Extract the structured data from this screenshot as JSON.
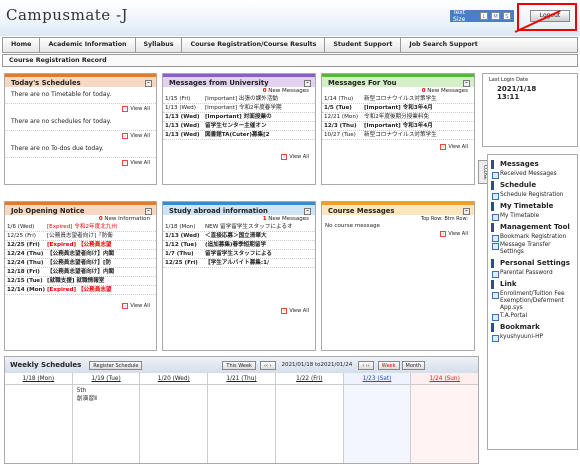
{
  "header": {
    "brand": "Campusmate -J",
    "text_size_label": "Text Size",
    "sizes": [
      "L",
      "M",
      "S"
    ],
    "logout": "Logout"
  },
  "nav": [
    "Home",
    "Academic Information",
    "Syllabus",
    "Course Registration/Course Results",
    "Student Support",
    "Job Search Support"
  ],
  "subnav": "Course Registration Record",
  "panels": {
    "todays": {
      "title": "Today's Schedules",
      "timetable": "There are no Timetable for today.",
      "schedules": "There are no schedules for today.",
      "todos": "There are no To-dos due today.",
      "view_all": "View All"
    },
    "university": {
      "title": "Messages from University",
      "new_count": "0",
      "new_label": "New Messages",
      "view_all": "View All",
      "rows": [
        {
          "date": "1/15 (Fri)",
          "text": "[Important] 出張の課外活動"
        },
        {
          "date": "1/13 (Wed)",
          "text": "[Important] 令和2年度春学期"
        },
        {
          "date": "1/13 (Wed)",
          "text": "[Important] 対面授業の"
        },
        {
          "date": "1/13 (Wed)",
          "text": "留学生センター主催オン"
        },
        {
          "date": "1/13 (Wed)",
          "text": "図書館TA(Cuter)募集[2"
        }
      ]
    },
    "foryou": {
      "title": "Messages For You",
      "new_count": "0",
      "new_label": "New Messages",
      "view_all": "View All",
      "rows": [
        {
          "date": "1/14 (Thu)",
          "text": "新型コロナウイルス対策学生"
        },
        {
          "date": "1/5 (Tue)",
          "text": "[Important] 令和3年4月"
        },
        {
          "date": "12/21 (Mon)",
          "text": "令和2年度後期分授業料免"
        },
        {
          "date": "12/3 (Thu)",
          "text": "[Important] 令和3年4月"
        },
        {
          "date": "10/27 (Tue)",
          "text": "新型コロナウイルス対策学生"
        }
      ]
    },
    "jobs": {
      "title": "Job Opening Notice",
      "new_count": "0",
      "new_label": "New Information",
      "view_all": "View All",
      "rows": [
        {
          "date": "1/6 (Wed)",
          "text": "[Expired] 令和2年度北九州"
        },
        {
          "date": "12/25 (Fri)",
          "text": "[公務員志望者向け]「防衛"
        },
        {
          "date": "12/25 (Fri)",
          "text": "[Expired] 【公務員志望"
        },
        {
          "date": "12/24 (Thu)",
          "text": "【公務員志望者向け】内閣"
        },
        {
          "date": "12/24 (Thu)",
          "text": "【公務員志望者向け】[防"
        },
        {
          "date": "12/18 (Fri)",
          "text": "【公務員志望者向け】内閣"
        },
        {
          "date": "12/15 (Tue)",
          "text": "[就職支援] 就職情報室"
        },
        {
          "date": "12/14 (Mon)",
          "text": "[Expired] 【公務員志望"
        }
      ]
    },
    "abroad": {
      "title": "Study abroad information",
      "new_count": "1",
      "new_label": "New Messages",
      "view_all": "View All",
      "rows": [
        {
          "date": "1/18 (Mon)",
          "text": "NEW 留学留学生スタッフによるオ"
        },
        {
          "date": "1/13 (Wed)",
          "text": "＜直接応募＞国立清華大"
        },
        {
          "date": "1/12 (Tue)",
          "text": "(追加募集)春季短期留学"
        },
        {
          "date": "1/7 (Thu)",
          "text": "留学留学生スタッフによる"
        },
        {
          "date": "12/25 (Fri)",
          "text": "【学生アルバイト募集:1/"
        }
      ]
    },
    "course": {
      "title": "Course Messages",
      "top_row": "Top Row:",
      "btm_row": "Btm Row:",
      "none": "No course message",
      "view_all": "View All"
    }
  },
  "weekly": {
    "title": "Weekly Schedules",
    "register": "Register Schedule",
    "this_week": "This Week",
    "range": "2021/01/18 to2021/01/24",
    "week": "Week",
    "month": "Month",
    "days": [
      "1/18 (Mon)",
      "1/19 (Tue)",
      "1/20 (Wed)",
      "1/21 (Thu)",
      "1/22 (Fri)",
      "1/23 (Sat)",
      "1/24 (Sun)"
    ],
    "entry": {
      "period": "5th",
      "course": "創演習Ⅱ"
    }
  },
  "login": {
    "label": "Last Login Date",
    "date": "2021/1/18",
    "time": "13:11"
  },
  "side": {
    "tab": "CLOSE",
    "sections": [
      {
        "head": "Messages",
        "items": [
          "Received Messages"
        ]
      },
      {
        "head": "Schedule",
        "items": [
          "Schedule Registration"
        ]
      },
      {
        "head": "My Timetable",
        "items": [
          "My Timetable"
        ]
      },
      {
        "head": "Management Tool",
        "items": [
          "Bookmark Registration",
          "Message Transfer Settings"
        ]
      },
      {
        "head": "Personal Settings",
        "items": [
          "Parental Password"
        ]
      },
      {
        "head": "Link",
        "items": [
          "Enrollment/Tuition Fee Exemption/Deferment App.sys",
          "T.A.Portal"
        ]
      },
      {
        "head": "Bookmark",
        "items": [
          "kyushyuuni-HP"
        ]
      }
    ]
  }
}
